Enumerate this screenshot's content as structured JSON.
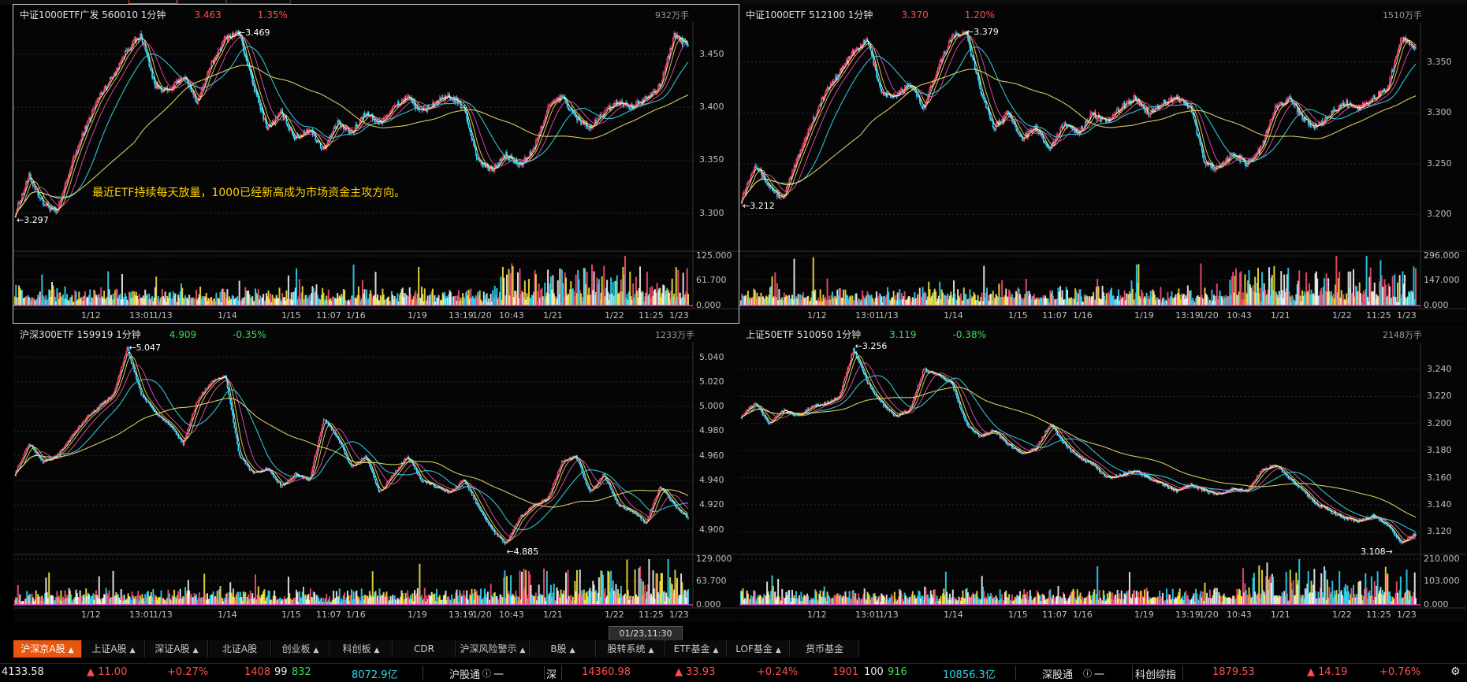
{
  "panels": [
    {
      "id": "p1",
      "name": "中证1000ETF广发 560010 1分钟",
      "price": "3.463",
      "change": "1.35%",
      "dir": "up",
      "vol_total": "932万手",
      "yticks": [
        "3.450",
        "3.400",
        "3.350",
        "3.300"
      ],
      "vticks": [
        "125.000",
        "61.700",
        "0.000"
      ],
      "xticks": [
        "1/12",
        "13:01",
        "1/13",
        "1/14",
        "1/15",
        "11:07",
        "1/16",
        "1/19",
        "13:19",
        "1/20",
        "10:43",
        "1/21",
        "1/22",
        "11:25",
        "1/23"
      ],
      "high_mark": "3.469",
      "low_mark": "3.297",
      "annotation": "最近ETF持续每天放量，1000已经新高成为市场资金主攻方向。",
      "series": [
        3.299,
        3.335,
        3.31,
        3.3,
        3.345,
        3.38,
        3.41,
        3.43,
        3.455,
        3.468,
        3.42,
        3.415,
        3.43,
        3.405,
        3.44,
        3.466,
        3.47,
        3.42,
        3.38,
        3.395,
        3.37,
        3.38,
        3.36,
        3.385,
        3.375,
        3.395,
        3.385,
        3.4,
        3.41,
        3.395,
        3.405,
        3.41,
        3.4,
        3.35,
        3.34,
        3.355,
        3.345,
        3.36,
        3.4,
        3.41,
        3.39,
        3.38,
        3.395,
        3.405,
        3.4,
        3.41,
        3.42,
        3.468,
        3.458
      ]
    },
    {
      "id": "p2",
      "name": "中证1000ETF 512100 1分钟",
      "price": "3.370",
      "change": "1.20%",
      "dir": "up",
      "vol_total": "1510万手",
      "yticks": [
        "3.350",
        "3.300",
        "3.250",
        "3.200"
      ],
      "vticks": [
        "296.000",
        "147.000",
        "0.000"
      ],
      "xticks": [
        "1/12",
        "13:01",
        "1/13",
        "1/14",
        "1/15",
        "11:07",
        "1/16",
        "1/19",
        "13:19",
        "1/20",
        "10:43",
        "1/21",
        "1/22",
        "11:25",
        "1/23"
      ],
      "high_mark": "3.379",
      "low_mark": "3.212",
      "annotation": "",
      "series": [
        3.214,
        3.25,
        3.228,
        3.215,
        3.255,
        3.29,
        3.32,
        3.34,
        3.36,
        3.372,
        3.32,
        3.315,
        3.33,
        3.305,
        3.345,
        3.375,
        3.379,
        3.325,
        3.285,
        3.3,
        3.275,
        3.285,
        3.265,
        3.29,
        3.28,
        3.3,
        3.29,
        3.305,
        3.315,
        3.3,
        3.31,
        3.315,
        3.305,
        3.25,
        3.245,
        3.26,
        3.25,
        3.265,
        3.305,
        3.315,
        3.295,
        3.285,
        3.3,
        3.31,
        3.305,
        3.315,
        3.325,
        3.375,
        3.365
      ]
    },
    {
      "id": "p3",
      "name": "沪深300ETF 159919 1分钟",
      "price": "4.909",
      "change": "-0.35%",
      "dir": "down",
      "vol_total": "1233万手",
      "yticks": [
        "5.040",
        "5.020",
        "5.000",
        "4.980",
        "4.960",
        "4.940",
        "4.920",
        "4.900"
      ],
      "vticks": [
        "129.000",
        "63.700",
        "0.000"
      ],
      "xticks": [
        "1/12",
        "13:01",
        "1/13",
        "1/14",
        "1/15",
        "11:07",
        "1/16",
        "1/19",
        "13:19",
        "1/20",
        "10:43",
        "1/21",
        "1/22",
        "11:25",
        "1/23"
      ],
      "high_mark": "5.047",
      "low_mark": "4.885",
      "annotation": "",
      "series": [
        4.945,
        4.97,
        4.955,
        4.96,
        4.975,
        4.99,
        5.0,
        5.01,
        5.047,
        5.01,
        4.995,
        4.985,
        4.97,
        5.005,
        5.02,
        5.025,
        4.96,
        4.945,
        4.95,
        4.935,
        4.945,
        4.94,
        4.99,
        4.975,
        4.95,
        4.96,
        4.93,
        4.945,
        4.96,
        4.94,
        4.935,
        4.93,
        4.94,
        4.92,
        4.9,
        4.888,
        4.91,
        4.92,
        4.925,
        4.955,
        4.96,
        4.93,
        4.945,
        4.92,
        4.915,
        4.905,
        4.935,
        4.92,
        4.909
      ]
    },
    {
      "id": "p4",
      "name": "上证50ETF 510050 1分钟",
      "price": "3.119",
      "change": "-0.38%",
      "dir": "down",
      "vol_total": "2148万手",
      "yticks": [
        "3.240",
        "3.220",
        "3.200",
        "3.180",
        "3.160",
        "3.140",
        "3.120"
      ],
      "vticks": [
        "210.000",
        "103.000",
        "0.000"
      ],
      "xticks": [
        "1/12",
        "13:01",
        "1/13",
        "1/14",
        "1/15",
        "11:07",
        "1/16",
        "1/19",
        "13:19",
        "1/20",
        "10:43",
        "1/21",
        "1/22",
        "11:25",
        "1/23"
      ],
      "high_mark": "3.256",
      "low_mark": "3.108",
      "annotation": "",
      "series": [
        3.205,
        3.215,
        3.2,
        3.21,
        3.205,
        3.212,
        3.215,
        3.22,
        3.255,
        3.23,
        3.215,
        3.205,
        3.21,
        3.24,
        3.235,
        3.23,
        3.2,
        3.19,
        3.195,
        3.185,
        3.178,
        3.182,
        3.2,
        3.185,
        3.175,
        3.17,
        3.16,
        3.162,
        3.165,
        3.16,
        3.155,
        3.15,
        3.155,
        3.15,
        3.148,
        3.152,
        3.15,
        3.165,
        3.17,
        3.16,
        3.15,
        3.14,
        3.135,
        3.13,
        3.128,
        3.132,
        3.125,
        3.112,
        3.119
      ]
    }
  ],
  "time_tip": "01/23,11:30",
  "tabs": [
    {
      "label": "沪深京A股",
      "caret": true,
      "sel": true
    },
    {
      "label": "上证A股",
      "caret": true
    },
    {
      "label": "深证A股",
      "caret": true
    },
    {
      "label": "北证A股",
      "caret": false
    },
    {
      "label": "创业板",
      "caret": true
    },
    {
      "label": "科创板",
      "caret": true
    },
    {
      "label": "CDR",
      "caret": false
    },
    {
      "label": "沪深风险警示",
      "caret": true
    },
    {
      "label": "B股",
      "caret": true
    },
    {
      "label": "股转系统",
      "caret": true
    },
    {
      "label": "ETF基金",
      "caret": true
    },
    {
      "label": "LOF基金",
      "caret": true
    },
    {
      "label": "货币基金",
      "caret": false
    }
  ],
  "status": {
    "sh_index": "4133.58",
    "sh_chg": "▲ 11.00",
    "sh_pct": "+0.27%",
    "sh_up": "1408",
    "sh_flat": "99",
    "sh_down": "832",
    "sh_amount": "8072.9亿",
    "hgt_label": "沪股通",
    "hgt_val": "一",
    "sz_label": "深",
    "sz_index": "14360.98",
    "sz_chg": "▲ 33.93",
    "sz_pct": "+0.24%",
    "sz_up": "1901",
    "sz_flat": "100",
    "sz_down": "916",
    "sz_amount": "10856.3亿",
    "sgt_label": "深股通",
    "sgt_val": "一",
    "kc_label": "科创综指",
    "kc_index": "1879.53",
    "kc_chg": "▲ 14.19",
    "kc_pct": "+0.76%"
  }
}
